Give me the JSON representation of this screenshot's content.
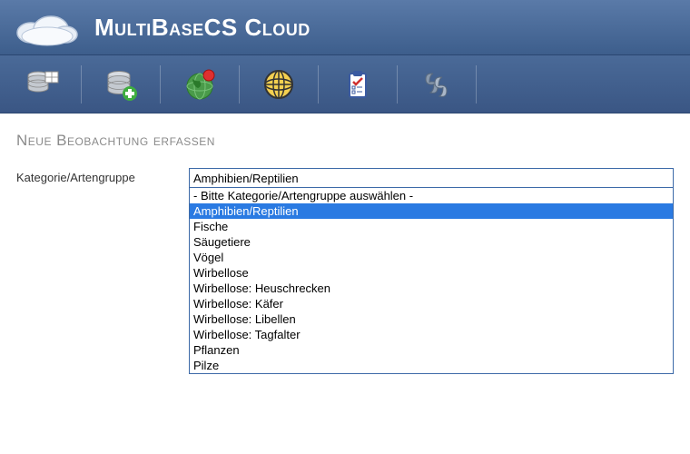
{
  "header": {
    "app_title": "MultiBaseCS Cloud"
  },
  "toolbar": {
    "items": [
      {
        "name": "database-icon"
      },
      {
        "name": "database-add-icon"
      },
      {
        "name": "globe-notify-icon"
      },
      {
        "name": "globe-grid-icon"
      },
      {
        "name": "clipboard-check-icon"
      },
      {
        "name": "paragraph-icon"
      }
    ]
  },
  "page": {
    "title": "Neue Beobachtung erfassen"
  },
  "form": {
    "category_label": "Kategorie/Artengruppe",
    "category_value": "Amphibien/Reptilien",
    "category_options": [
      "- Bitte Kategorie/Artengruppe auswählen -",
      "Amphibien/Reptilien",
      "Fische",
      "Säugetiere",
      "Vögel",
      "Wirbellose",
      "Wirbellose: Heuschrecken",
      "Wirbellose: Käfer",
      "Wirbellose: Libellen",
      "Wirbellose: Tagfalter",
      "Pflanzen",
      "Pilze"
    ],
    "category_selected_index": 1
  }
}
